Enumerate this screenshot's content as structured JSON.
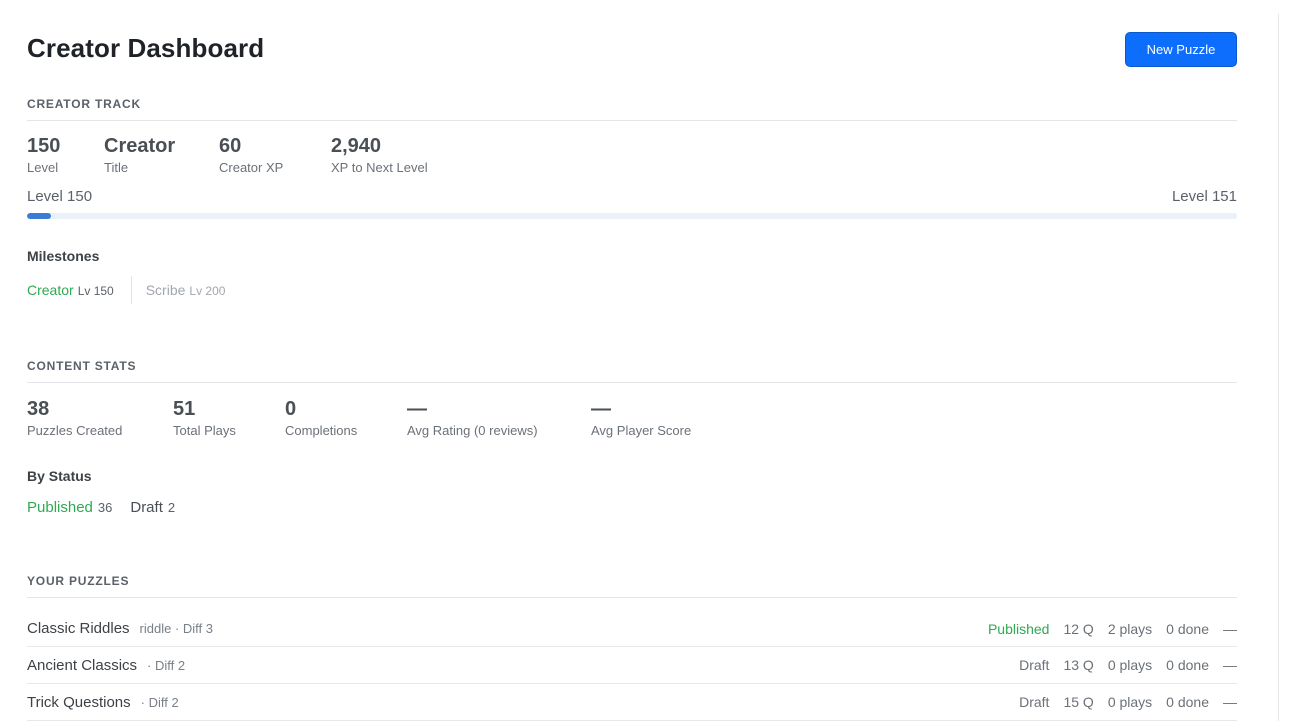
{
  "header": {
    "title": "Creator Dashboard",
    "new_button": "New Puzzle"
  },
  "creator_track": {
    "heading": "CREATOR TRACK",
    "stats": [
      {
        "value": "150",
        "label": "Level"
      },
      {
        "value": "Creator",
        "label": "Title"
      },
      {
        "value": "60",
        "label": "Creator XP"
      },
      {
        "value": "2,940",
        "label": "XP to Next Level"
      }
    ],
    "level_from": "Level 150",
    "level_to": "Level 151",
    "progress_fraction": 0.02,
    "milestones_heading": "Milestones",
    "milestones": [
      {
        "name": "Creator",
        "level": "Lv 150",
        "achieved": true
      },
      {
        "name": "Scribe",
        "level": "Lv 200",
        "achieved": false
      }
    ]
  },
  "content_stats": {
    "heading": "CONTENT STATS",
    "stats": [
      {
        "value": "38",
        "label": "Puzzles Created"
      },
      {
        "value": "51",
        "label": "Total Plays"
      },
      {
        "value": "0",
        "label": "Completions"
      },
      {
        "value": "—",
        "label": "Avg Rating (0 reviews)"
      },
      {
        "value": "—",
        "label": "Avg Player Score"
      }
    ],
    "by_status_heading": "By Status",
    "status": [
      {
        "name": "Published",
        "count": "36"
      },
      {
        "name": "Draft",
        "count": "2"
      }
    ]
  },
  "your_puzzles": {
    "heading": "YOUR PUZZLES",
    "rows": [
      {
        "name": "Classic Riddles",
        "meta": "riddle · Diff 3",
        "status": "Published",
        "questions": "12 Q",
        "plays": "2 plays",
        "done": "0 done",
        "rating": "—"
      },
      {
        "name": "Ancient Classics",
        "meta": "· Diff 2",
        "status": "Draft",
        "questions": "13 Q",
        "plays": "0 plays",
        "done": "0 done",
        "rating": "—"
      },
      {
        "name": "Trick Questions",
        "meta": "· Diff 2",
        "status": "Draft",
        "questions": "15 Q",
        "plays": "0 plays",
        "done": "0 done",
        "rating": "—"
      }
    ]
  },
  "colors": {
    "accent": "#0d6efd",
    "success": "#2eaa52",
    "progress": "#3a7bd5"
  }
}
